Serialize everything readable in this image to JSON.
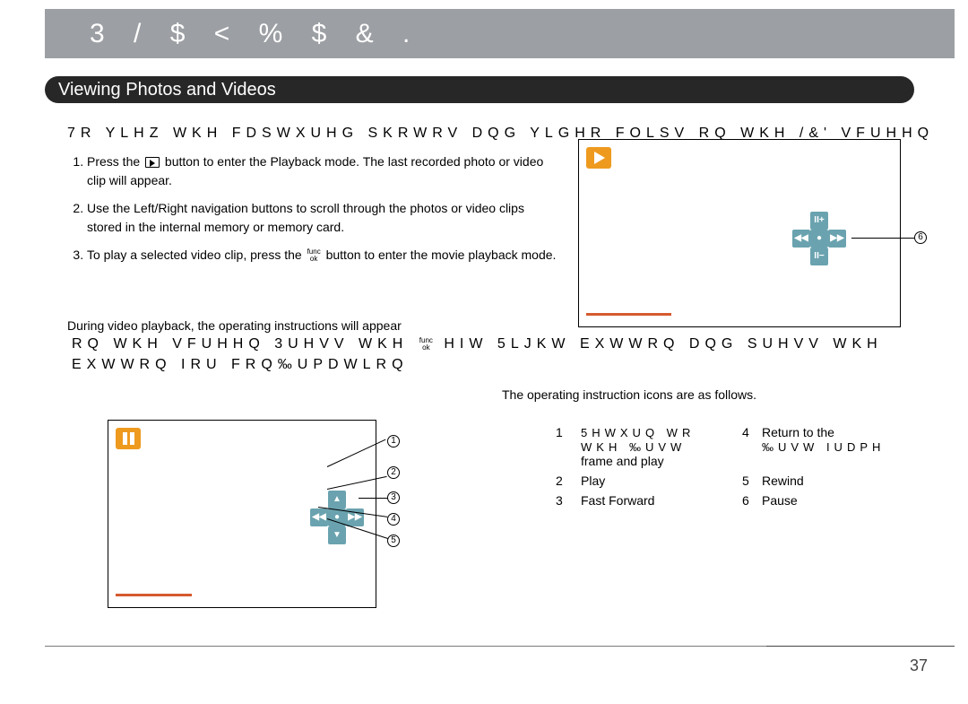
{
  "banner": {
    "title": "3 / $ < % $ & ."
  },
  "section": {
    "title": "Viewing Photos and Videos"
  },
  "intro_corrupted": "7R  YLHZ  WKH  FDSWXUHG  SKRWRV  DQG  YLGHR  FOLSV  RQ  WKH  /&'  VFUHHQ",
  "steps": {
    "s1a": "Press the ",
    "s1b": " button to enter the Playback mode. The last recorded photo or video clip will appear.",
    "s2": "Use the Left/Right navigation buttons to scroll through the photos or video clips stored in the internal memory or memory card.",
    "s3a": "To play a selected video clip, press the ",
    "s3b": " button to enter the movie playback mode."
  },
  "func_ok": {
    "top": "func",
    "bot": "ok"
  },
  "during": "During video playback, the operating instructions will appear",
  "corrupted1a": "RQ  WKH  VFUHHQ   3UHVV  WKH",
  "corrupted1b": "HIW  5LJKW  EXWWRQ   DQG  SUHVV  WKH",
  "corrupted2": "EXWWRQ  IRU  FRQ‰UPDWLRQ",
  "oper_desc": "The operating instruction icons are as follows.",
  "legend": {
    "r1a": "5HWXUQ  WR  WKH  ‰UVW",
    "r1a2": "frame and play",
    "r1b": "Return to the",
    "r1b2": "‰UVW  IUDPH",
    "r2a": "Play",
    "r2b": "Rewind",
    "r3a": "Fast Forward",
    "r3b": "Pause"
  },
  "callouts": {
    "c1": "1",
    "c2": "2",
    "c3": "3",
    "c4": "4",
    "c5": "5",
    "c6": "6"
  },
  "page_number": "37"
}
